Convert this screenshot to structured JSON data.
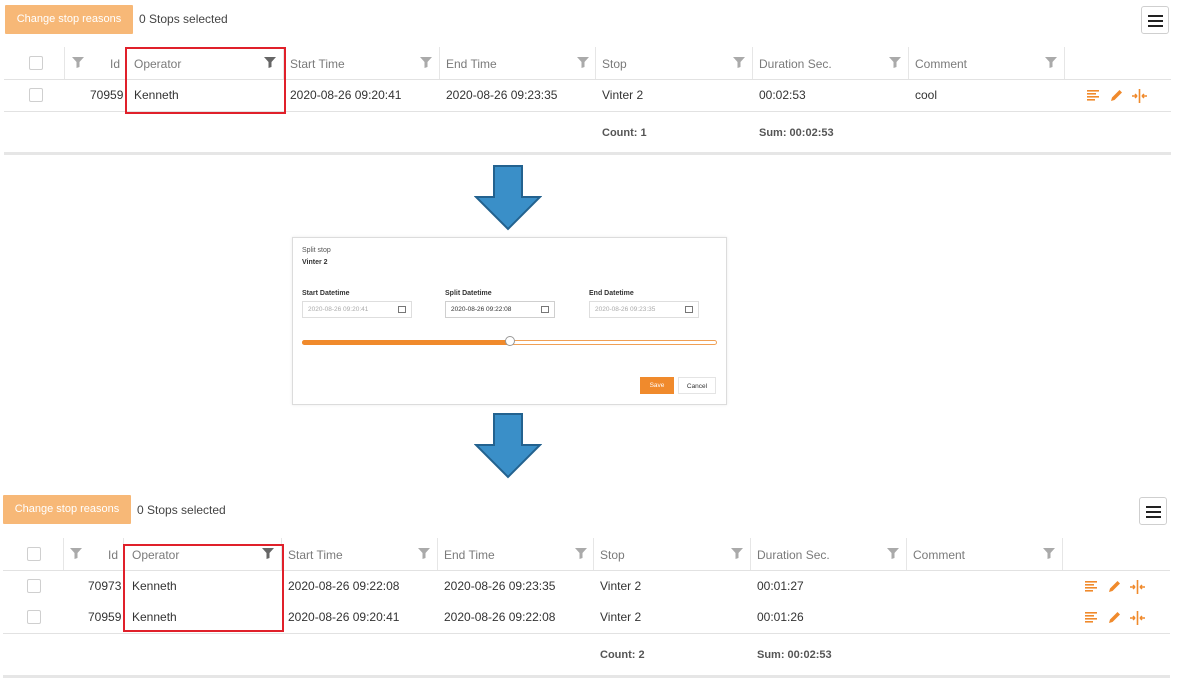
{
  "toolbar": {
    "change_stop_reasons_label": "Change stop reasons",
    "stops_selected_top": "0 Stops selected",
    "stops_selected_bottom": "0 Stops selected"
  },
  "columns": [
    "Id",
    "Operator",
    "Start Time",
    "End Time",
    "Stop",
    "Duration Sec.",
    "Comment"
  ],
  "top_grid": {
    "rows": [
      {
        "id": "70959",
        "operator": "Kenneth",
        "start": "2020-08-26 09:20:41",
        "end": "2020-08-26 09:23:35",
        "stop": "Vinter 2",
        "duration": "00:02:53",
        "comment": "cool"
      }
    ],
    "count": "Count: 1",
    "sum": "Sum: 00:02:53"
  },
  "dialog": {
    "title": "Split stop",
    "subtitle": "Vinter 2",
    "start_label": "Start Datetime",
    "start_value": "2020-08-26 09:20:41",
    "split_label": "Split Datetime",
    "split_value": "2020-08-26 09:22:08",
    "end_label": "End Datetime",
    "end_value": "2020-08-26 09:23:35",
    "slider_fraction": 0.5,
    "save_label": "Save",
    "cancel_label": "Cancel"
  },
  "bottom_grid": {
    "rows": [
      {
        "id": "70973",
        "operator": "Kenneth",
        "start": "2020-08-26 09:22:08",
        "end": "2020-08-26 09:23:35",
        "stop": "Vinter 2",
        "duration": "00:01:27",
        "comment": ""
      },
      {
        "id": "70959",
        "operator": "Kenneth",
        "start": "2020-08-26 09:20:41",
        "end": "2020-08-26 09:22:08",
        "stop": "Vinter 2",
        "duration": "00:01:26",
        "comment": ""
      }
    ],
    "count": "Count: 2",
    "sum": "Sum: 00:02:53"
  },
  "colors": {
    "accent": "#f08a2c",
    "button": "#f7b877",
    "highlight_box": "#e0202a",
    "arrow": "#3a8fc8"
  },
  "icons": [
    "filter-icon",
    "details-icon",
    "edit-icon",
    "split-icon",
    "menu-icon",
    "calendar-icon",
    "down-arrow"
  ]
}
